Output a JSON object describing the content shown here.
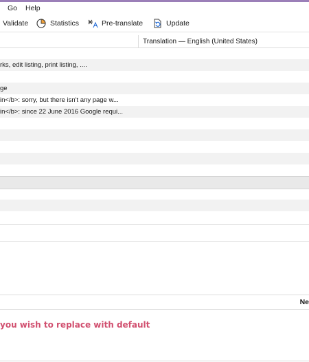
{
  "menu": {
    "go": "Go",
    "help": "Help"
  },
  "toolbar": {
    "validate": "Validate",
    "statistics": "Statistics",
    "pretranslate": "Pre-translate",
    "update": "Update"
  },
  "table": {
    "translation_header": "Translation — English (United States)",
    "rows": [
      {
        "text": ""
      },
      {
        "text": "rks, edit listing, print listing, ...."
      },
      {
        "text": ""
      },
      {
        "text": ""
      },
      {
        "text": "ge"
      },
      {
        "text": "in</b>: sorry, but there isn't any page w..."
      },
      {
        "text": "in</b>: since 22 June 2016 Google requi..."
      },
      {
        "text": ""
      },
      {
        "text": ""
      },
      {
        "text": ""
      },
      {
        "text": ""
      },
      {
        "text": ""
      },
      {
        "text": ""
      },
      {
        "text": ""
      },
      {
        "text": ""
      },
      {
        "text": ""
      }
    ]
  },
  "details": {
    "column_partial": "Ne"
  },
  "warning": {
    "text": "you wish to replace with default"
  },
  "colors": {
    "accent": "#9b7fb8",
    "warning": "#d14f6f"
  }
}
